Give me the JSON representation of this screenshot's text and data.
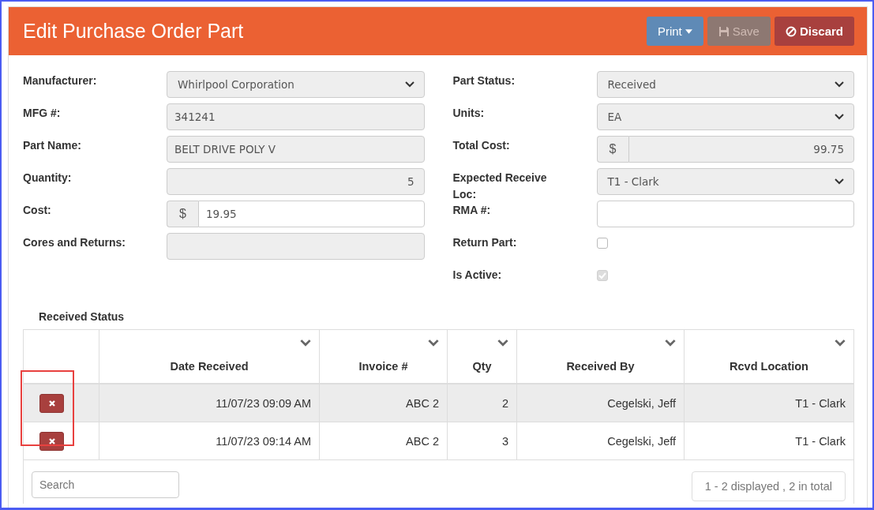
{
  "header": {
    "title": "Edit Purchase Order Part",
    "buttons": [
      {
        "kind": "print",
        "label": "Print",
        "disabled": false
      },
      {
        "kind": "save",
        "label": "Save",
        "disabled": true
      },
      {
        "kind": "discard",
        "label": "Discard",
        "disabled": false
      }
    ]
  },
  "left_fields": [
    {
      "label": "Manufacturer:",
      "kind": "select",
      "value": "Whirlpool Corporation",
      "disabled": true
    },
    {
      "label": "MFG #:",
      "kind": "text",
      "value": "341241",
      "disabled": true
    },
    {
      "label": "Part Name:",
      "kind": "text",
      "value": "BELT DRIVE POLY V",
      "disabled": true
    },
    {
      "label": "Quantity:",
      "kind": "number",
      "value": "5",
      "disabled": true
    },
    {
      "label": "Cost:",
      "kind": "currency",
      "prefix": "$",
      "value": "19.95",
      "disabled": false
    },
    {
      "label": "Cores and Returns:",
      "kind": "text",
      "disabled": true
    }
  ],
  "right_fields": [
    {
      "label": "Part Status:",
      "kind": "select",
      "value": "Received",
      "disabled": true
    },
    {
      "label": "Units:",
      "kind": "select",
      "value": "EA",
      "disabled": true
    },
    {
      "label": "Total Cost:",
      "kind": "currency_right",
      "prefix": "$",
      "value": "99.75",
      "disabled": true
    },
    {
      "label": "Expected Receive Loc:",
      "kind": "select",
      "value": "T1 - Clark",
      "disabled": true
    },
    {
      "label": "RMA #:",
      "kind": "text",
      "disabled": false
    },
    {
      "label": "Return Part:",
      "kind": "checkbox",
      "checked": false,
      "disabled": false
    },
    {
      "label": "Is Active:",
      "kind": "checkbox",
      "checked": true,
      "disabled": true
    }
  ],
  "received_status": {
    "title": "Received Status",
    "highlight_delete_column": true,
    "columns": [
      "Date Received",
      "Invoice #",
      "Qty",
      "Received By",
      "Rcvd Location"
    ],
    "rows": [
      {
        "selected": true,
        "cells": [
          "11/07/23 09:09 AM",
          "ABC 2",
          "2",
          "Cegelski, Jeff",
          "T1 - Clark"
        ]
      },
      {
        "selected": false,
        "cells": [
          "11/07/23 09:14 AM",
          "ABC 2",
          "3",
          "Cegelski, Jeff",
          "T1 - Clark"
        ]
      }
    ],
    "search": {
      "placeholder": "Search"
    },
    "pager": "1 - 2 displayed , 2 in total"
  }
}
